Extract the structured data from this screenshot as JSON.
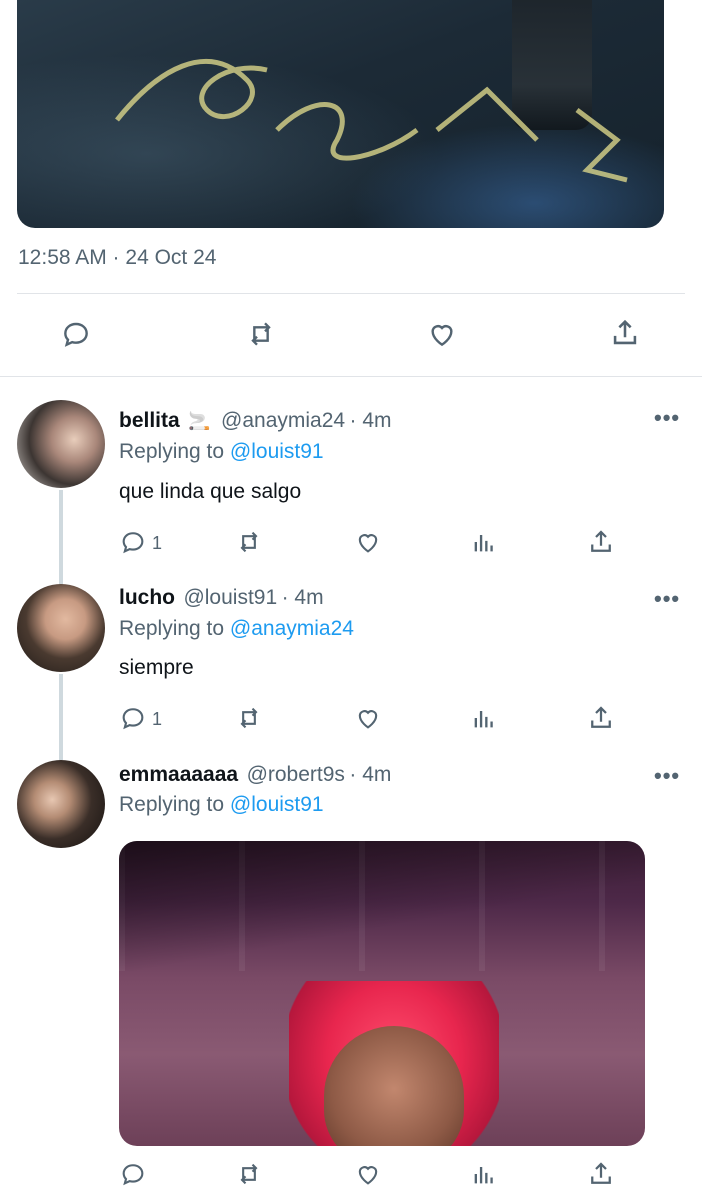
{
  "main_tweet": {
    "timestamp": "12:58 AM · 24 Oct 24",
    "actions": [
      "reply-icon",
      "retweet-icon",
      "like-icon",
      "share-icon"
    ]
  },
  "replies": [
    {
      "name": "bellita",
      "emoji": "🚬",
      "handle": "@anaymia24",
      "time": "· 4m",
      "replying_prefix": "Replying to",
      "replying_to": "@louist91",
      "text": "que linda que salgo",
      "reply_count": "1",
      "more": "•••"
    },
    {
      "name": "lucho",
      "handle": "@louist91",
      "time": "· 4m",
      "replying_prefix": "Replying to",
      "replying_to": "@anaymia24",
      "text": "siempre",
      "reply_count": "1",
      "more": "•••"
    },
    {
      "name": "emmaaaaaa",
      "handle": "@robert9s",
      "time": "· 4m",
      "replying_prefix": "Replying to",
      "replying_to": "@louist91",
      "more": "•••"
    }
  ],
  "colors": {
    "link": "#1d9bf0",
    "secondary_text": "#536471",
    "primary_text": "#0f1419",
    "divider": "#e1e4e8"
  }
}
